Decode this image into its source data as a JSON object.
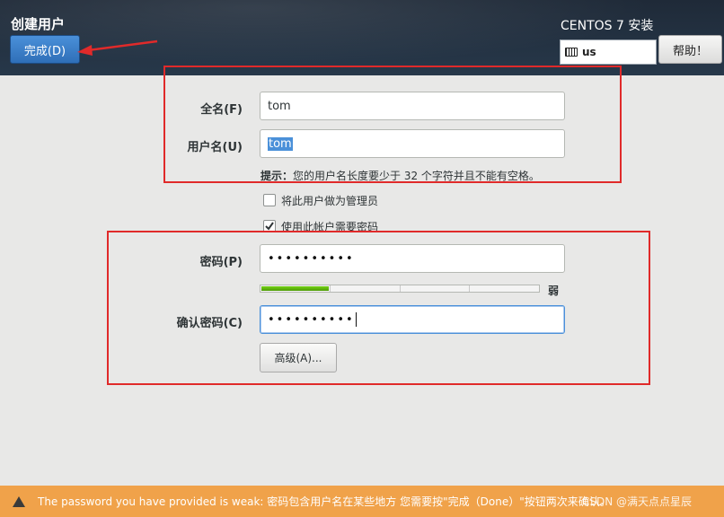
{
  "header": {
    "title": "创建用户",
    "done_label": "完成(D)",
    "product": "CENTOS 7 安装",
    "keyboard_layout": "us",
    "help_label": "帮助！"
  },
  "form": {
    "fullname_label": "全名(F)",
    "fullname_value": "tom",
    "username_label": "用户名(U)",
    "username_value": "tom",
    "hint_prefix": "提示：",
    "hint_text": "您的用户名长度要少于 32 个字符并且不能有空格。",
    "admin_checkbox_label": "将此用户做为管理员",
    "admin_checked": false,
    "require_password_label": "使用此帐户需要密码",
    "require_password_checked": true,
    "password_label": "密码(P)",
    "password_masked": "••••••••••",
    "strength_label": "弱",
    "strength_level": 0.25,
    "confirm_label": "确认密码(C)",
    "confirm_masked": "••••••••••",
    "advanced_label": "高级(A)..."
  },
  "warning": {
    "text": "The password you have provided is weak: 密码包含用户名在某些地方 您需要按\"完成（Done）\"按钮两次来确认。",
    "watermark": "CSDN @满天点点星辰"
  },
  "colors": {
    "header_bg": "#27384a",
    "accent_blue": "#4a90d9",
    "annotation_red": "#e02a2a",
    "warning_bg": "#f0a24a",
    "strength_green": "#4e9a06"
  }
}
